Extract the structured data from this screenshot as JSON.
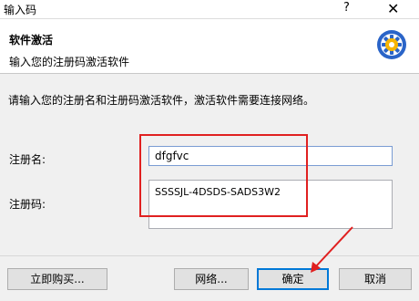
{
  "window": {
    "title": "输入码",
    "help_glyph": "?",
    "close_glyph": "✕"
  },
  "header": {
    "title": "软件激活",
    "subtitle": "输入您的注册码激活软件"
  },
  "intro_text": "请输入您的注册名和注册码激活软件，激活软件需要连接网络。",
  "form": {
    "name_label": "注册名:",
    "name_value": "dfgfvc",
    "code_label": "注册码:",
    "code_value": "SSSSJL-4DSDS-SADS3W2"
  },
  "buttons": {
    "buy": "立即购买...",
    "network": "网络...",
    "ok": "确定",
    "cancel": "取消"
  },
  "colors": {
    "annotation": "#e02020",
    "accent": "#0078d7"
  }
}
